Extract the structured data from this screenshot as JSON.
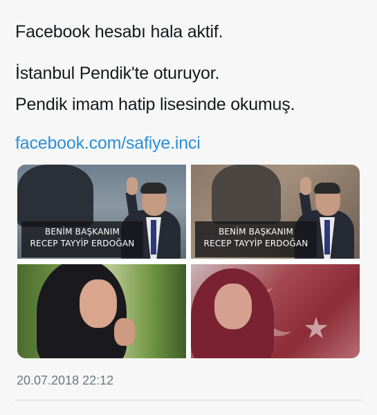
{
  "tweet": {
    "line1": "Facebook hesabı hala aktif.",
    "line2": "İstanbul Pendik'te oturuyor.",
    "line3": "Pendik imam hatip lisesinde okumuş.",
    "link": "facebook.com/safiye.inci",
    "timestamp": "20.07.2018 22:12"
  },
  "media": {
    "caption1_line1": "BENİM BAŞKANIM",
    "caption1_line2": "RECEP TAYYİP ERDOĞAN",
    "caption2_line1": "BENİM BAŞKANIM",
    "caption2_line2": "RECEP TAYYİP ERDOĞAN"
  },
  "colors": {
    "link": "#2b8fd6",
    "text": "#16191c",
    "timestamp": "#6c7780"
  }
}
